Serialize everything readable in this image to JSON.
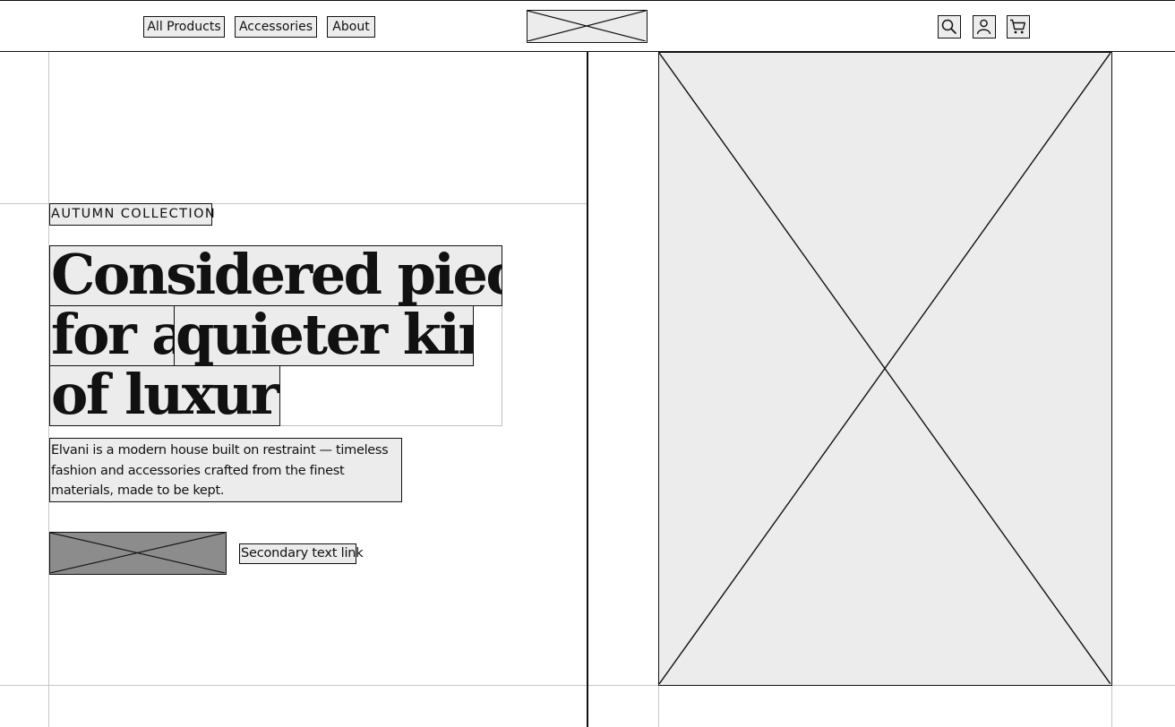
{
  "nav": {
    "items": [
      {
        "label": "All Products"
      },
      {
        "label": "Accessories"
      },
      {
        "label": "About"
      }
    ],
    "icons": [
      "search-icon",
      "account-icon",
      "cart-icon"
    ]
  },
  "hero": {
    "eyebrow": "AUTUMN COLLECTION",
    "headline_lines": [
      "Considered pieces",
      "for a",
      "quieter kind",
      "of luxury."
    ],
    "body": "Elvani is a modern house built on restraint — timeless fashion and accessories crafted from the finest materials, made to be kept.",
    "secondary_link": "Secondary text link"
  },
  "colors": {
    "placeholder_fill": "#ececec",
    "cta_fill": "#8c8c8c",
    "stroke": "#111111",
    "guide": "#c6c6c6"
  }
}
